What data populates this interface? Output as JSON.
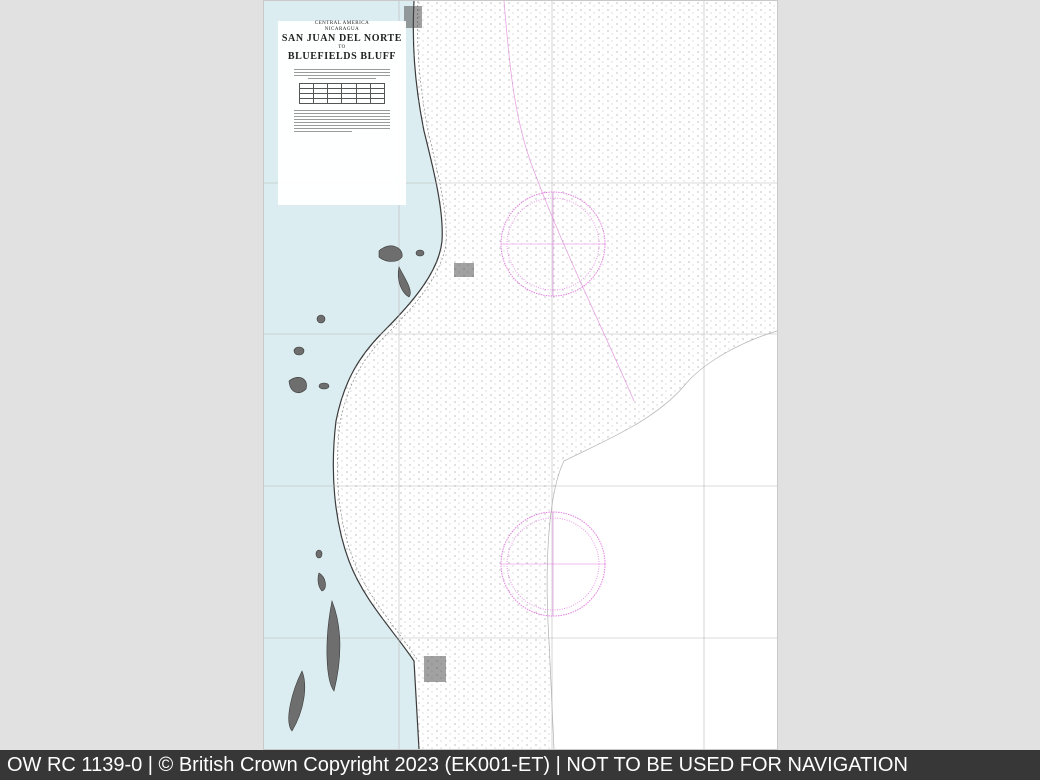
{
  "chart": {
    "title": {
      "region": "CENTRAL AMERICA",
      "country": "NICARAGUA",
      "place_from": "SAN JUAN DEL NORTE",
      "connector": "TO",
      "place_to": "BLUEFIELDS BLUFF"
    },
    "colors": {
      "sea_shallow": "#dcedf1",
      "land": "#ffffff",
      "compass_rose": "#e27fe0",
      "graticule": "#b8b8b8",
      "soundings": "#8a8a8a",
      "coast": "#3a3a3a"
    }
  },
  "footer": {
    "text": "OW RC 1139-0 | © British Crown Copyright 2023 (EK001-ET) | NOT TO BE USED FOR NAVIGATION",
    "background": "#373737"
  }
}
